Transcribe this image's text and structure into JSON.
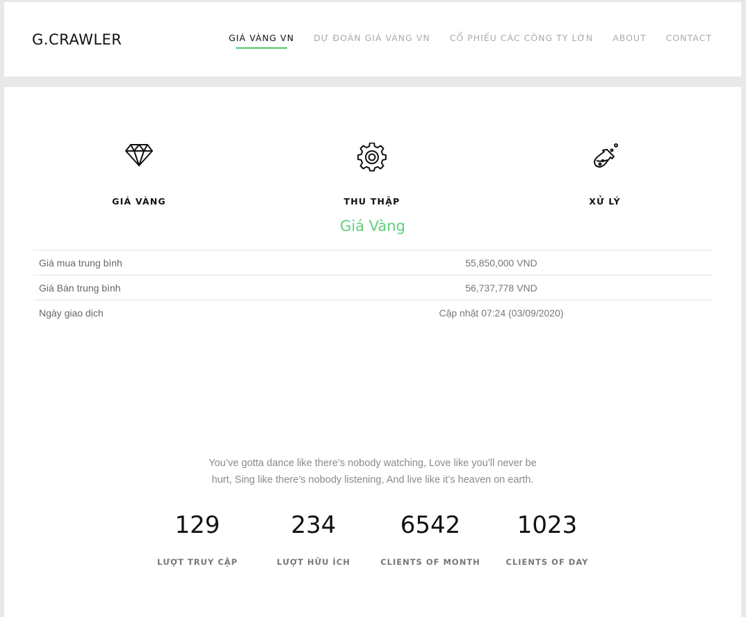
{
  "header": {
    "brand": "G.CRAWLER",
    "nav": [
      {
        "label": "GIÁ VÀNG VN",
        "active": true
      },
      {
        "label": "DỰ ĐOÁN GIÁ VÀNG VN"
      },
      {
        "label": "CỔ PHIẾU CÁC CÔNG TY LỚN"
      },
      {
        "label": "ABOUT"
      },
      {
        "label": "CONTACT"
      }
    ]
  },
  "features": [
    {
      "icon": "diamond-icon",
      "label": "GIÁ VÀNG"
    },
    {
      "icon": "gear-icon",
      "label": "THU THẬP"
    },
    {
      "icon": "flask-icon",
      "label": "XỬ LÝ"
    }
  ],
  "section": {
    "title": "Giá Vàng",
    "accent": "#5fcf7a"
  },
  "price_table": [
    {
      "key": "Giá mua trung bình",
      "value": "55,850,000 VND"
    },
    {
      "key": "Giá Bán trung bình",
      "value": "56,737,778 VND"
    },
    {
      "key": "Ngày giao dịch",
      "value": "Cập nhật 07:24 (03/09/2020)"
    }
  ],
  "quote": "You’ve gotta dance like there’s nobody watching, Love like you’ll never be hurt, Sing like there’s nobody listening, And live like it’s heaven on earth.",
  "stats": [
    {
      "value": "129",
      "label": "LƯỢT TRUY CẬP"
    },
    {
      "value": "234",
      "label": "LƯỢT HỮU ÍCH"
    },
    {
      "value": "6542",
      "label": "CLIENTS OF MONTH"
    },
    {
      "value": "1023",
      "label": "CLIENTS OF DAY"
    }
  ]
}
